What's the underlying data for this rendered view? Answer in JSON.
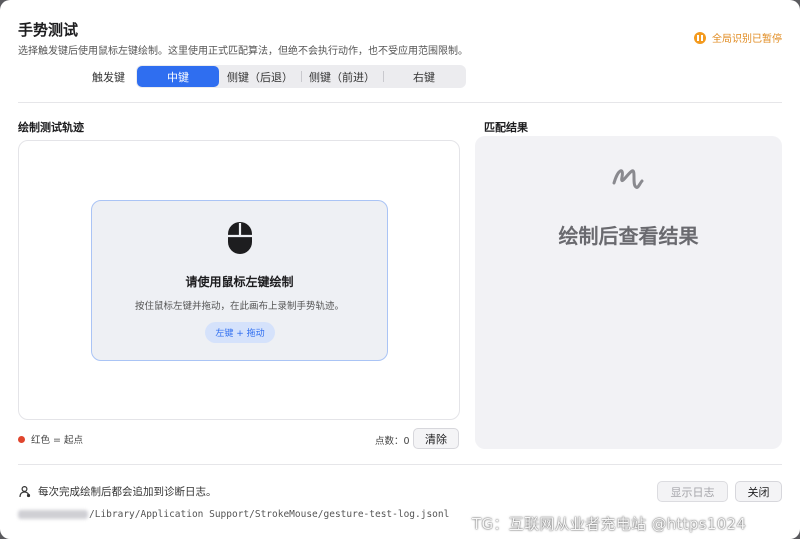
{
  "window": {
    "title": "手势测试",
    "subtitle": "选择触发键后使用鼠标左键绘制。这里使用正式匹配算法，但绝不会执行动作，也不受应用范围限制。",
    "status": {
      "label": "全局识别已暂停",
      "color": "#f39a1e",
      "icon": "pause-icon"
    }
  },
  "trigger": {
    "label": "触发键",
    "options": [
      "中键",
      "侧键（后退）",
      "侧键（前进）",
      "右键"
    ],
    "selected": "中键",
    "accent": "#2f6ef0"
  },
  "draw_panel": {
    "section_title": "绘制测试轨迹",
    "prompt": {
      "icon": "mouse-icon",
      "title": "请使用鼠标左键绘制",
      "description": "按住鼠标左键并拖动，在此画布上录制手势轨迹。",
      "hint": "左键 + 拖动"
    },
    "legend": "红色 = 起点",
    "legend_color": "#e0452d",
    "points_label": "点数：0",
    "clear_label": "清除"
  },
  "result_panel": {
    "section_title": "匹配结果",
    "icon": "gesture-squiggle-icon",
    "placeholder": "绘制后查看结果"
  },
  "footer": {
    "note_icon": "diagnostic-icon",
    "note": "每次完成绘制后都会追加到诊断日志。",
    "log_path": "/Library/Application Support/StrokeMouse/gesture-test-log.jsonl",
    "show_log_label": "显示日志",
    "close_label": "关闭"
  },
  "watermark": "TG：互联网从业者充电站 @https1024"
}
